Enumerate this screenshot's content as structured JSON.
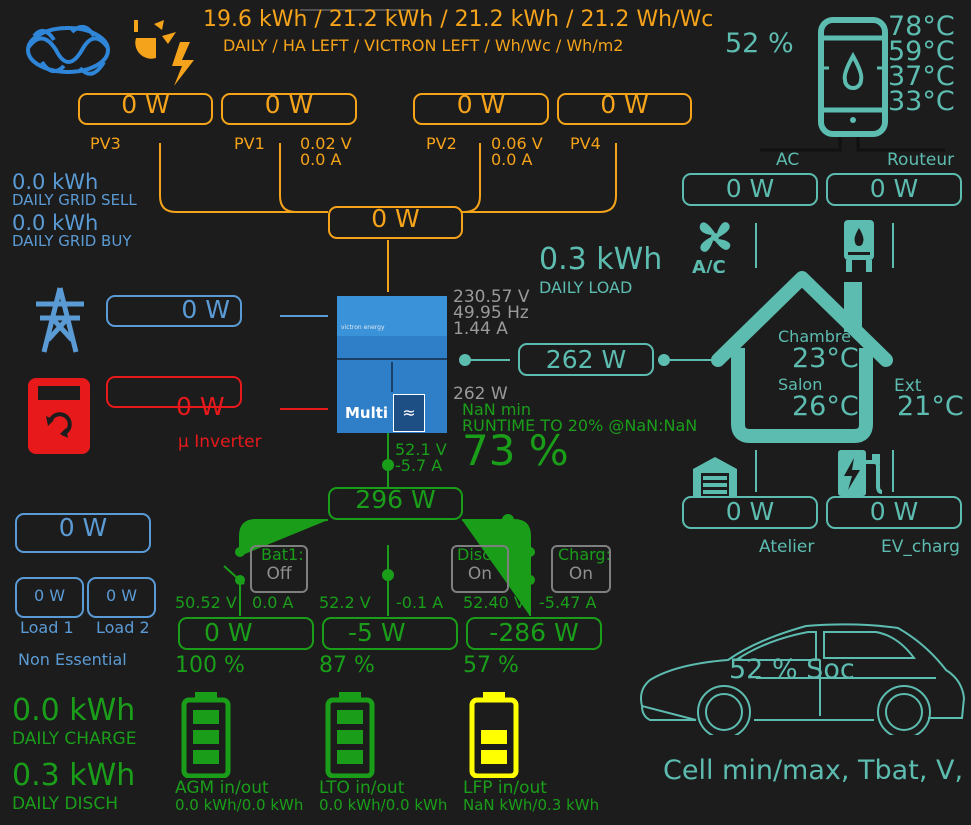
{
  "header": {
    "energy_line": "19.6 kWh / 21.2 kWh / 21.2 kWh / 21.2 Wh/Wc",
    "energy_caption": "DAILY / HA LEFT / VICTRON LEFT / Wh/Wc / Wh/m2"
  },
  "pv": {
    "pv3": {
      "power": "0 W",
      "label": "PV3"
    },
    "pv1": {
      "power": "0 W",
      "label": "PV1",
      "voltage": "0.02 V",
      "current": "0.0 A"
    },
    "pv2": {
      "power": "0 W",
      "label": "PV2",
      "voltage": "0.06 V",
      "current": "0.0 A"
    },
    "pv4": {
      "power": "0 W",
      "label": "PV4"
    },
    "total": "0 W"
  },
  "grid": {
    "sell_value": "0.0 kWh",
    "sell_label": "DAILY GRID SELL",
    "buy_value": "0.0 kWh",
    "buy_label": "DAILY GRID BUY",
    "power": "0 W"
  },
  "micro_inverter": {
    "power": "0 W",
    "label": "µ Inverter"
  },
  "inverter": {
    "ac_voltage": "230.57 V",
    "frequency": "49.95 Hz",
    "ac_current": "1.44 A",
    "out_power": "262 W",
    "brand": "victron energy",
    "model": "Multi",
    "dc_voltage": "52.1 V",
    "dc_current": "-5.7 A"
  },
  "runtime": {
    "min": "NaN min",
    "text": "RUNTIME TO 20% @NaN:NaN",
    "soc": "73 %"
  },
  "load": {
    "daily_value": "0.3 kWh",
    "daily_label": "DAILY LOAD",
    "power": "262 W"
  },
  "non_essential": {
    "power": "0 W",
    "load1_power": "0 W",
    "load1_label": "Load 1",
    "load2_power": "0 W",
    "load2_label": "Load 2",
    "label": "Non Essential"
  },
  "battery_bus": {
    "power": "296 W"
  },
  "switches": {
    "bat1": {
      "label": "Bat1:",
      "state": "Off"
    },
    "disch": {
      "label": "Disch:",
      "state": "On"
    },
    "charg": {
      "label": "Charg:",
      "state": "On"
    }
  },
  "batteries": [
    {
      "voltage": "50.52 V",
      "current": "0.0 A",
      "power": "0 W",
      "soc": "100 %",
      "name": "AGM in/out",
      "energy": "0.0 kWh/0.0 kWh",
      "color": "#1a9e1a"
    },
    {
      "voltage": "52.2 V",
      "current": "-0.1 A",
      "power": "-5 W",
      "soc": "87 %",
      "name": "LTO in/out",
      "energy": "0.0 kWh/0.0 kWh",
      "color": "#1a9e1a"
    },
    {
      "voltage": "52.40 V",
      "current": "-5.47 A",
      "power": "-286 W",
      "soc": "57 %",
      "name": "LFP in/out",
      "energy": "NaN kWh/0.3 kWh",
      "color": "#ffff00"
    }
  ],
  "daily": {
    "charge_value": "0.0 kWh",
    "charge_label": "DAILY CHARGE",
    "disch_value": "0.3 kWh",
    "disch_label": "DAILY DISCH"
  },
  "boiler": {
    "percent": "52 %",
    "temps": [
      "78°C",
      "59°C",
      "37°C",
      "33°C"
    ]
  },
  "loads_right": {
    "ac": {
      "label": "AC",
      "power": "0 W"
    },
    "routeur": {
      "label": "Routeur",
      "power": "0 W"
    },
    "atelier": {
      "label": "Atelier",
      "power": "0 W"
    },
    "ev": {
      "label": "EV_charg",
      "power": "0 W"
    }
  },
  "house": {
    "room1_label": "Chambre",
    "room1_temp": "23°C",
    "room2_label": "Salon",
    "room2_temp": "26°C",
    "ext_label": "Ext",
    "ext_temp": "21°C"
  },
  "car": {
    "soc": "52 % Soc",
    "cell_info": "Cell min/max, Tbat, V,"
  },
  "colors": {
    "pv": "#f5a31a",
    "grid": "#5b9bd5",
    "load": "#5dbcb0",
    "battery": "#1a9e1a",
    "micro": "#e8191b",
    "lfp": "#ffff00"
  },
  "icons": [
    "victron-logo-icon",
    "sun-lightning-icon",
    "pylon-icon",
    "micro-inverter-icon",
    "boiler-icon",
    "fan-ac-icon",
    "router-icon",
    "house-icon",
    "garage-icon",
    "ev-charger-icon",
    "battery-icon",
    "car-icon"
  ]
}
